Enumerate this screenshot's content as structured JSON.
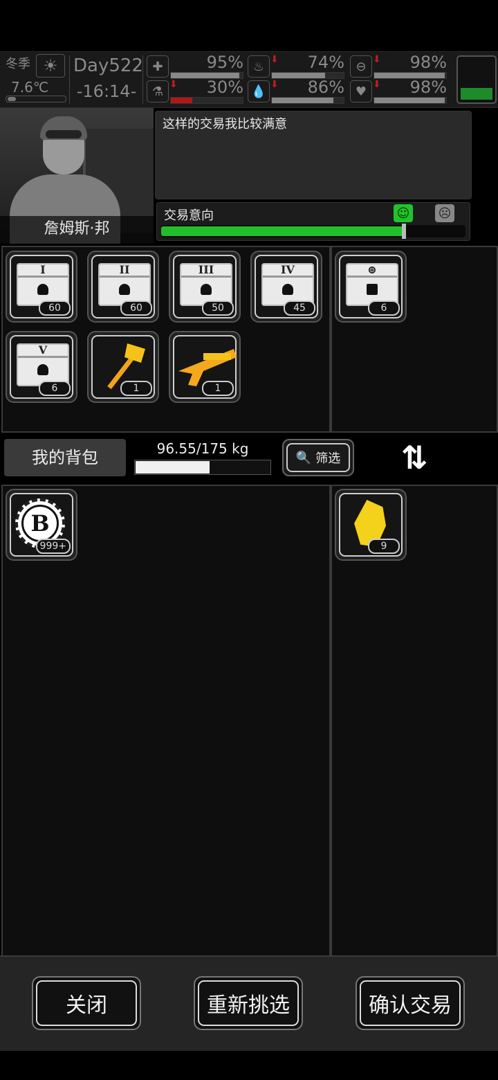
{
  "status": {
    "season": "冬季",
    "temperature": "7.6℃",
    "day": "Day522",
    "time": "-16:14-",
    "stats": [
      {
        "icon": "medkit-icon",
        "glyph": "✚",
        "value": "95%",
        "fraction": 0.95,
        "warning": false
      },
      {
        "icon": "stomach-icon",
        "glyph": "♨",
        "value": "74%",
        "fraction": 0.74,
        "warning": true
      },
      {
        "icon": "pill-icon",
        "glyph": "⊖",
        "value": "98%",
        "fraction": 0.98,
        "warning": true
      },
      {
        "icon": "flask-icon",
        "glyph": "⚗",
        "value": "30%",
        "fraction": 0.3,
        "warning": true
      },
      {
        "icon": "water-drop-icon",
        "glyph": "💧",
        "value": "86%",
        "fraction": 0.86,
        "warning": true
      },
      {
        "icon": "heart-icon",
        "glyph": "♥",
        "value": "98%",
        "fraction": 0.98,
        "warning": true
      }
    ],
    "battery_level": 0.3
  },
  "npc": {
    "name": "詹姆斯·邦",
    "dialog": "这样的交易我比较满意",
    "intent_label": "交易意向",
    "intent_level": 0.8
  },
  "trader_items": [
    {
      "name": "crate-i",
      "numeral": "I",
      "count": "60"
    },
    {
      "name": "crate-ii",
      "numeral": "II",
      "count": "60"
    },
    {
      "name": "crate-iii",
      "numeral": "III",
      "count": "50"
    },
    {
      "name": "crate-iv",
      "numeral": "IV",
      "count": "45"
    },
    {
      "name": "crate-v",
      "numeral": "V",
      "count": "6"
    },
    {
      "name": "golden-hammer",
      "numeral": "",
      "count": "1"
    },
    {
      "name": "golden-gun",
      "numeral": "",
      "count": "1"
    }
  ],
  "trader_offer": [
    {
      "name": "special-crate",
      "count": "6"
    }
  ],
  "bag": {
    "label": "我的背包",
    "weight": "96.55/175 kg",
    "weight_fraction": 0.5517,
    "filter_label": "筛选",
    "items": [
      {
        "name": "coin",
        "count": "999+"
      }
    ],
    "offer": [
      {
        "name": "yellow-crystal",
        "count": "9"
      }
    ]
  },
  "buttons": {
    "close": "关闭",
    "reselect": "重新挑选",
    "confirm": "确认交易"
  }
}
